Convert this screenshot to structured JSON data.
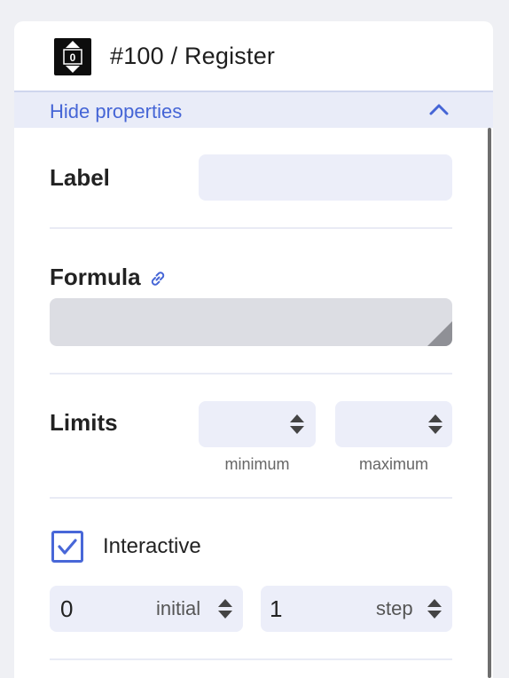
{
  "header": {
    "icon": "register-counter-icon",
    "icon_digit": "0",
    "title": "#100 / Register"
  },
  "toggle": {
    "label": "Hide properties",
    "icon": "chevron-up-icon"
  },
  "label_field": {
    "label": "Label",
    "value": ""
  },
  "formula": {
    "label": "Formula",
    "link_icon": "link-icon",
    "value": ""
  },
  "limits": {
    "label": "Limits",
    "minimum": {
      "value": "",
      "hint": "minimum"
    },
    "maximum": {
      "value": "",
      "hint": "maximum"
    }
  },
  "interactive": {
    "label": "Interactive",
    "checked": true
  },
  "initial": {
    "value": "0",
    "tag": "initial"
  },
  "step": {
    "value": "1",
    "tag": "step"
  },
  "colors": {
    "accent": "#4565d6",
    "toggle_bg": "#e9ecf8",
    "input_bg": "#eceef9",
    "textarea_bg": "#dcdde3"
  }
}
